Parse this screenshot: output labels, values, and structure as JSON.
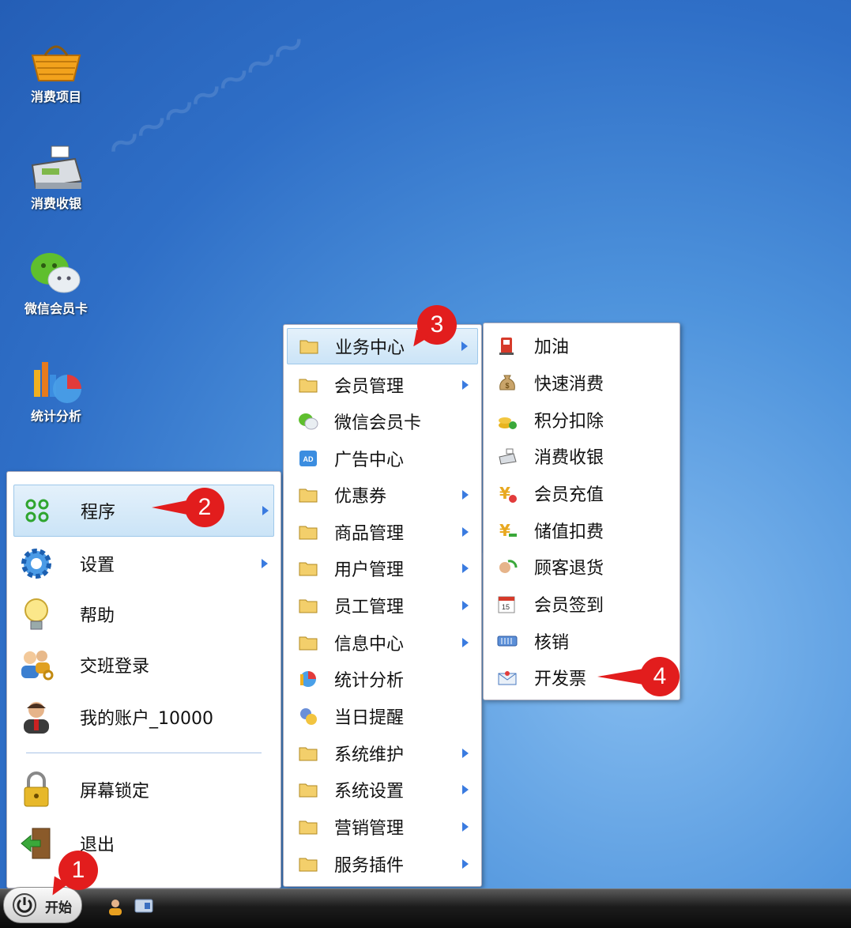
{
  "desktop_icons": [
    {
      "label": "消费项目",
      "icon": "basket-icon"
    },
    {
      "label": "消费收银",
      "icon": "cash-register-icon"
    },
    {
      "label": "微信会员卡",
      "icon": "wechat-icon"
    },
    {
      "label": "统计分析",
      "icon": "chart-icon"
    }
  ],
  "start_menu": {
    "items": [
      {
        "label": "程序",
        "icon": "programs-icon",
        "has_submenu": true,
        "highlighted": true
      },
      {
        "label": "设置",
        "icon": "gear-icon",
        "has_submenu": true
      },
      {
        "label": "帮助",
        "icon": "lightbulb-icon"
      },
      {
        "label": "交班登录",
        "icon": "users-key-icon"
      },
      {
        "label": "我的账户_10000",
        "icon": "user-account-icon"
      },
      {
        "label": "屏幕锁定",
        "icon": "lock-icon"
      },
      {
        "label": "退出",
        "icon": "exit-door-icon"
      }
    ]
  },
  "program_menu": {
    "items": [
      {
        "label": "业务中心",
        "icon": "folder-icon",
        "has_submenu": true,
        "highlighted": true
      },
      {
        "label": "会员管理",
        "icon": "folder-icon",
        "has_submenu": true
      },
      {
        "label": "微信会员卡",
        "icon": "wechat-icon",
        "has_submenu": false
      },
      {
        "label": "广告中心",
        "icon": "ad-icon",
        "has_submenu": false
      },
      {
        "label": "优惠券",
        "icon": "folder-icon",
        "has_submenu": true
      },
      {
        "label": "商品管理",
        "icon": "folder-icon",
        "has_submenu": true
      },
      {
        "label": "用户管理",
        "icon": "folder-icon",
        "has_submenu": true
      },
      {
        "label": "员工管理",
        "icon": "folder-icon",
        "has_submenu": true
      },
      {
        "label": "信息中心",
        "icon": "folder-icon",
        "has_submenu": true
      },
      {
        "label": "统计分析",
        "icon": "chart-icon",
        "has_submenu": false
      },
      {
        "label": "当日提醒",
        "icon": "reminder-icon",
        "has_submenu": false
      },
      {
        "label": "系统维护",
        "icon": "folder-icon",
        "has_submenu": true
      },
      {
        "label": "系统设置",
        "icon": "folder-icon",
        "has_submenu": true
      },
      {
        "label": "营销管理",
        "icon": "folder-icon",
        "has_submenu": true
      },
      {
        "label": "服务插件",
        "icon": "folder-icon",
        "has_submenu": true
      }
    ]
  },
  "business_menu": {
    "items": [
      {
        "label": "加油",
        "icon": "fuel-pump-icon"
      },
      {
        "label": "快速消费",
        "icon": "money-bag-icon"
      },
      {
        "label": "积分扣除",
        "icon": "points-icon"
      },
      {
        "label": "消费收银",
        "icon": "cash-register-icon"
      },
      {
        "label": "会员充值",
        "icon": "yuan-recharge-icon"
      },
      {
        "label": "储值扣费",
        "icon": "yuan-deduct-icon"
      },
      {
        "label": "顾客退货",
        "icon": "return-icon"
      },
      {
        "label": "会员签到",
        "icon": "calendar-icon"
      },
      {
        "label": "核销",
        "icon": "ticket-icon"
      },
      {
        "label": "开发票",
        "icon": "invoice-icon"
      }
    ]
  },
  "taskbar": {
    "start_label": "开始"
  },
  "callouts": [
    "1",
    "2",
    "3",
    "4"
  ],
  "colors": {
    "callout": "#e21d1d",
    "highlight": "#cbe4f7",
    "arrow": "#3a7be0"
  }
}
